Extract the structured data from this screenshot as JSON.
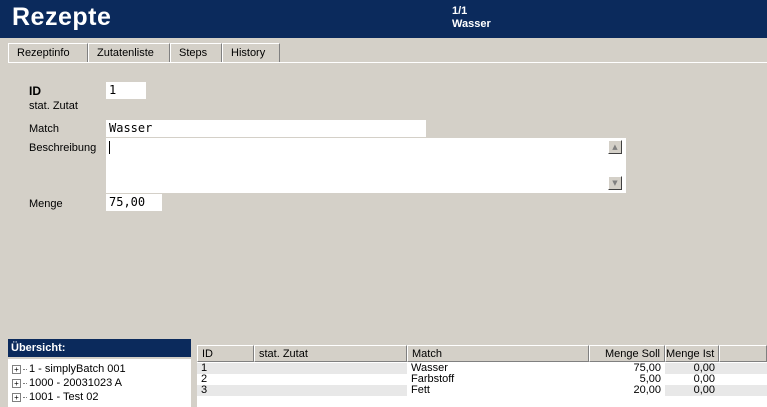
{
  "header": {
    "title": "Rezepte",
    "record_position": "1/1",
    "record_name": "Wasser"
  },
  "tabs": [
    {
      "label": "Rezeptinfo",
      "active": false
    },
    {
      "label": "Zutatenliste",
      "active": true
    },
    {
      "label": "Steps",
      "active": false
    },
    {
      "label": "History",
      "active": false
    }
  ],
  "form": {
    "id_label": "ID",
    "id_value": "1",
    "stat_zutat_label": "stat. Zutat",
    "match_label": "Match",
    "match_value": "Wasser",
    "beschreibung_label": "Beschreibung",
    "beschreibung_value": "",
    "menge_label": "Menge",
    "menge_value": "75,00"
  },
  "overview": {
    "title": "Übersicht:",
    "items": [
      {
        "label": "1 - simplyBatch 001"
      },
      {
        "label": "1000 - 20031023 A"
      },
      {
        "label": "1001 - Test 02"
      }
    ]
  },
  "grid": {
    "columns": [
      "ID",
      "stat. Zutat",
      "Match",
      "Menge Soll",
      "Menge Ist"
    ],
    "rows": [
      {
        "id": "1",
        "stat_zutat": "",
        "match": "Wasser",
        "menge_soll": "75,00",
        "menge_ist": "0,00"
      },
      {
        "id": "2",
        "stat_zutat": "",
        "match": "Farbstoff",
        "menge_soll": "5,00",
        "menge_ist": "0,00"
      },
      {
        "id": "3",
        "stat_zutat": "",
        "match": "Fett",
        "menge_soll": "20,00",
        "menge_ist": "0,00"
      }
    ]
  },
  "colors": {
    "header_bg": "#0b2a5c",
    "window_bg": "#d4d0c8"
  }
}
